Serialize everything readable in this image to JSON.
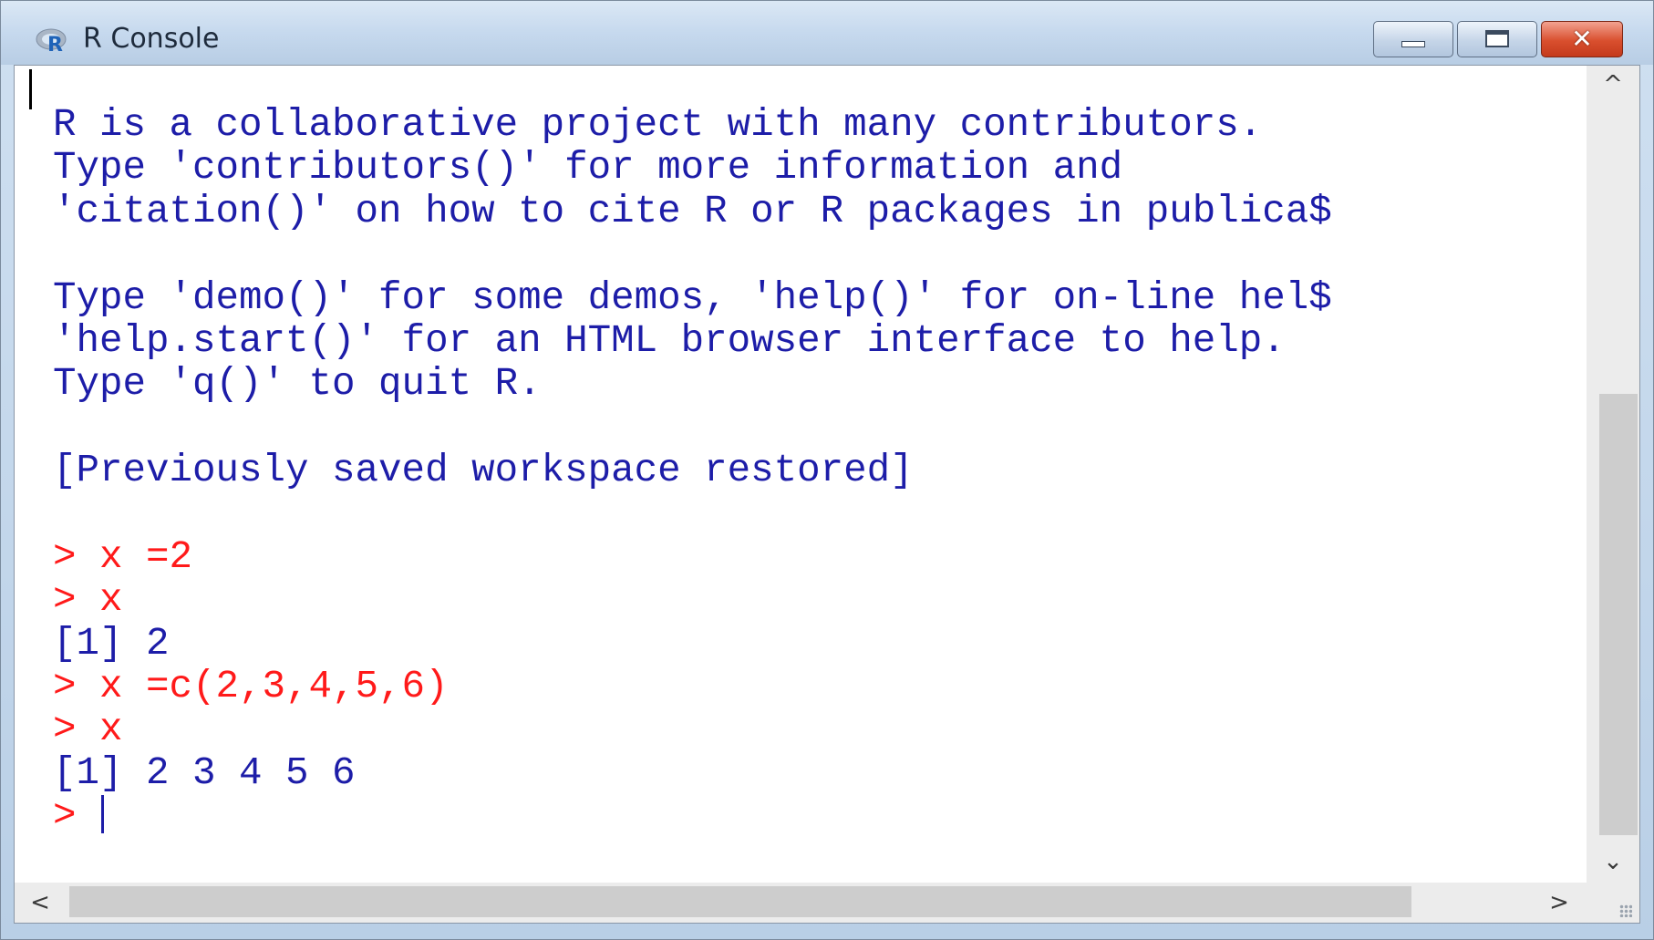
{
  "window": {
    "title": "R Console",
    "icon": "r-logo-icon"
  },
  "controls": {
    "minimize": "minimize-icon",
    "maximize": "maximize-icon",
    "close_glyph": "✕"
  },
  "console": {
    "lines": [
      {
        "text": "R is a collaborative project with many contributors.",
        "type": "output"
      },
      {
        "text": "Type 'contributors()' for more information and",
        "type": "output"
      },
      {
        "text": "'citation()' on how to cite R or R packages in publica$",
        "type": "output"
      },
      {
        "text": "",
        "type": "output"
      },
      {
        "text": "Type 'demo()' for some demos, 'help()' for on-line hel$",
        "type": "output"
      },
      {
        "text": "'help.start()' for an HTML browser interface to help.",
        "type": "output"
      },
      {
        "text": "Type 'q()' to quit R.",
        "type": "output"
      },
      {
        "text": "",
        "type": "output"
      },
      {
        "text": "[Previously saved workspace restored]",
        "type": "output"
      },
      {
        "text": "",
        "type": "output"
      },
      {
        "text": "> x =2",
        "type": "command"
      },
      {
        "text": "> x",
        "type": "command"
      },
      {
        "text": "[1] 2",
        "type": "output"
      },
      {
        "text": "> x =c(2,3,4,5,6)",
        "type": "command"
      },
      {
        "text": "> x",
        "type": "command"
      },
      {
        "text": "[1] 2 3 4 5 6",
        "type": "output"
      },
      {
        "text": "> ",
        "type": "prompt"
      }
    ]
  },
  "colors": {
    "output": "#1d1da8",
    "command": "#ff1a1a"
  },
  "scrollbars": {
    "up": "^",
    "down": "⌄",
    "left": "<",
    "right": ">"
  }
}
